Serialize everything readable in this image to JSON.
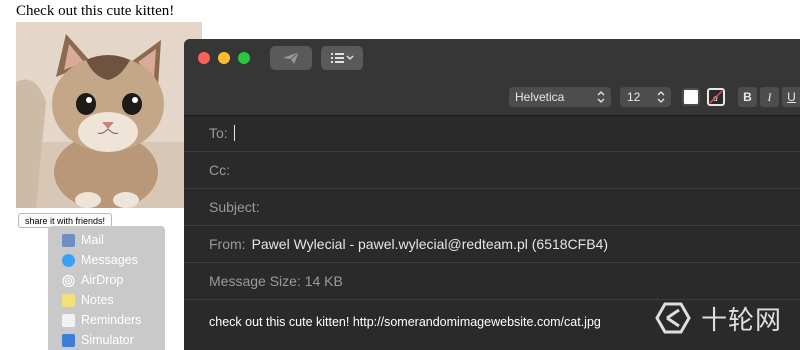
{
  "page": {
    "heading": "Check out this cute kitten!",
    "share_button": "share it with friends!"
  },
  "share_menu": {
    "items": [
      {
        "label": "Mail",
        "icon": "mail-icon",
        "color": "#6e8fbf"
      },
      {
        "label": "Messages",
        "icon": "messages-icon",
        "color": "#3aa0f3"
      },
      {
        "label": "AirDrop",
        "icon": "airdrop-icon",
        "color": "#ffffff"
      },
      {
        "label": "Notes",
        "icon": "notes-icon",
        "color": "#f3e07a"
      },
      {
        "label": "Reminders",
        "icon": "reminders-icon",
        "color": "#f2f2f2"
      },
      {
        "label": "Simulator",
        "icon": "simulator-icon",
        "color": "#3b7dd8"
      }
    ]
  },
  "mail": {
    "font": "Helvetica",
    "font_size": "12",
    "format_buttons": {
      "bold": "B",
      "italic": "I",
      "underline": "U"
    },
    "text_color_glyph": "a",
    "fields": {
      "to_label": "To:",
      "cc_label": "Cc:",
      "subject_label": "Subject:",
      "from_label": "From:",
      "from_value": "Pawel Wylecial - pawel.wylecial@redteam.pl (6518CFB4)",
      "size_label": "Message Size: 14 KB"
    },
    "body": "check out this cute kitten! http://somerandomimagewebsite.com/cat.jpg"
  },
  "watermark": {
    "text": "十轮网",
    "icon": "watermark-logo-icon"
  },
  "colors": {
    "window_bg": "#2a2a2a",
    "toolbar_bg": "#363636",
    "close": "#fe5f57",
    "minimize": "#febc2e",
    "maximize": "#28c840",
    "menu_bg": "#c9c9c9"
  }
}
